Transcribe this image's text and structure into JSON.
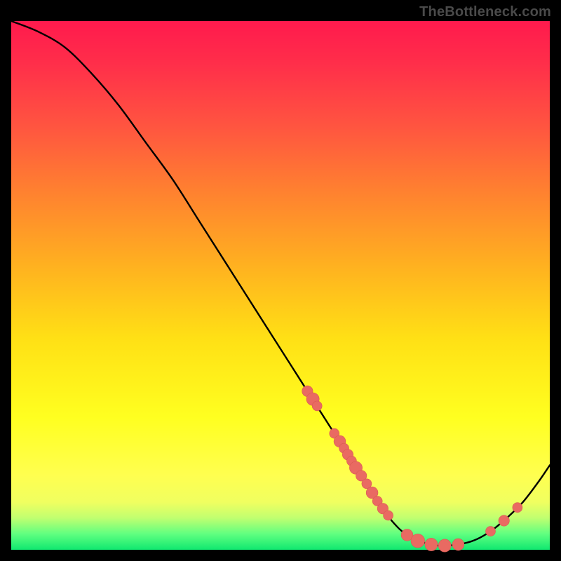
{
  "watermark": "TheBottleneck.com",
  "colors": {
    "curve_stroke": "#000000",
    "point_fill": "#e96a62",
    "point_stroke": "#d95a52"
  },
  "chart_data": {
    "type": "line",
    "title": "",
    "xlabel": "",
    "ylabel": "",
    "xlim": [
      0,
      100
    ],
    "ylim": [
      0,
      100
    ],
    "grid": false,
    "legend": false,
    "series": [
      {
        "name": "bottleneck-curve",
        "x": [
          0,
          5,
          10,
          15,
          20,
          25,
          30,
          35,
          40,
          45,
          50,
          55,
          60,
          62,
          65,
          68,
          72,
          75,
          78,
          80,
          83,
          86,
          89,
          92,
          95,
          98,
          100
        ],
        "y": [
          100,
          98,
          95,
          90,
          84,
          77,
          70,
          62,
          54,
          46,
          38,
          30,
          22,
          19,
          14,
          9,
          4,
          2,
          1,
          0.8,
          1.0,
          1.8,
          3.5,
          6.0,
          9.0,
          13.0,
          16.0
        ]
      }
    ],
    "points": [
      {
        "x": 55.0,
        "y": 30.0,
        "r": 1.1
      },
      {
        "x": 56.0,
        "y": 28.5,
        "r": 1.3
      },
      {
        "x": 56.8,
        "y": 27.2,
        "r": 1.0
      },
      {
        "x": 60.0,
        "y": 22.0,
        "r": 1.0
      },
      {
        "x": 61.0,
        "y": 20.5,
        "r": 1.2
      },
      {
        "x": 61.8,
        "y": 19.2,
        "r": 1.0
      },
      {
        "x": 62.5,
        "y": 18.0,
        "r": 1.1
      },
      {
        "x": 63.2,
        "y": 16.8,
        "r": 1.0
      },
      {
        "x": 64.0,
        "y": 15.5,
        "r": 1.3
      },
      {
        "x": 65.0,
        "y": 14.0,
        "r": 1.1
      },
      {
        "x": 66.0,
        "y": 12.5,
        "r": 1.0
      },
      {
        "x": 67.0,
        "y": 10.8,
        "r": 1.2
      },
      {
        "x": 68.0,
        "y": 9.2,
        "r": 1.0
      },
      {
        "x": 69.0,
        "y": 7.8,
        "r": 1.1
      },
      {
        "x": 70.0,
        "y": 6.5,
        "r": 1.0
      },
      {
        "x": 73.5,
        "y": 2.8,
        "r": 1.2
      },
      {
        "x": 75.5,
        "y": 1.7,
        "r": 1.4
      },
      {
        "x": 78.0,
        "y": 1.0,
        "r": 1.3
      },
      {
        "x": 80.5,
        "y": 0.8,
        "r": 1.3
      },
      {
        "x": 83.0,
        "y": 1.0,
        "r": 1.2
      },
      {
        "x": 89.0,
        "y": 3.5,
        "r": 1.0
      },
      {
        "x": 91.5,
        "y": 5.5,
        "r": 1.1
      },
      {
        "x": 94.0,
        "y": 8.0,
        "r": 1.0
      }
    ]
  }
}
